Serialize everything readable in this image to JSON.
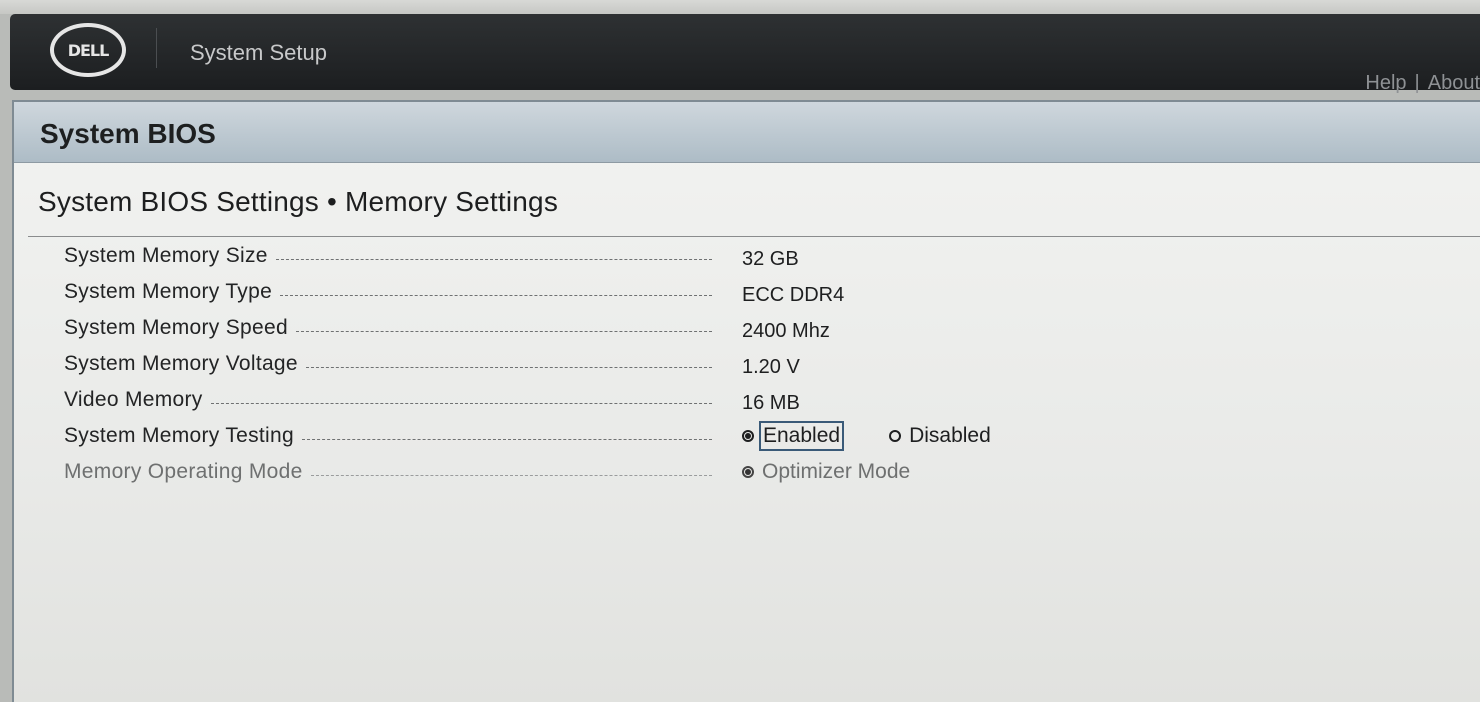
{
  "header": {
    "logo_text": "DELL",
    "app_title": "System Setup",
    "help_label": "Help",
    "separator": "|",
    "about_label": "About"
  },
  "section_bar": {
    "title": "System BIOS"
  },
  "page": {
    "title": "System BIOS Settings • Memory Settings"
  },
  "settings": {
    "memory_size": {
      "label": "System Memory Size",
      "value": "32 GB"
    },
    "memory_type": {
      "label": "System Memory Type",
      "value": "ECC DDR4"
    },
    "memory_speed": {
      "label": "System Memory Speed",
      "value": "2400 Mhz"
    },
    "memory_voltage": {
      "label": "System Memory Voltage",
      "value": "1.20 V"
    },
    "video_memory": {
      "label": "Video Memory",
      "value": "16 MB"
    },
    "memory_testing": {
      "label": "System Memory Testing",
      "options": [
        "Enabled",
        "Disabled"
      ],
      "selected": "Enabled"
    },
    "operating_mode": {
      "label": "Memory Operating Mode",
      "options": [
        "Optimizer Mode"
      ],
      "selected": "Optimizer Mode",
      "disabled": true
    }
  }
}
